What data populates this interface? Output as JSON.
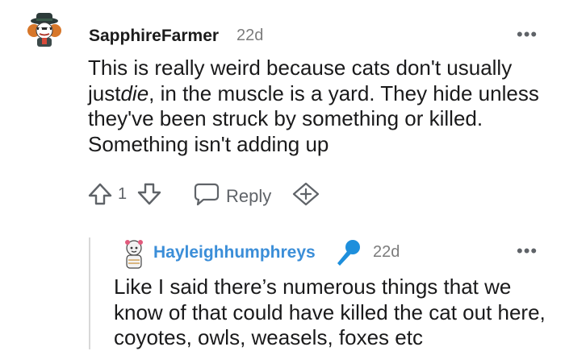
{
  "comment": {
    "username": "SapphireFarmer",
    "age": "22d",
    "text_before": "This is really weird because cats don't usually just",
    "text_italic": "die",
    "text_after": ", in the muscle is a yard. They hide unless they've been struck by something or killed. Something isn't adding up",
    "vote_count": "1",
    "reply_label": "Reply"
  },
  "reply": {
    "username": "Hayleighhumphreys",
    "age": "22d",
    "text": "Like I said there’s numerous things that we know of that could have killed the cat out here, coyotes, owls, weasels, foxes etc"
  },
  "icons": {
    "more": "more-options-icon",
    "upvote": "upvote-arrow-icon",
    "downvote": "downvote-arrow-icon",
    "reply": "speech-bubble-icon",
    "award": "plus-award-icon",
    "flair": "microphone-icon"
  },
  "colors": {
    "reply_username": "#3b8ed8",
    "microphone": "#1e8fdc"
  }
}
